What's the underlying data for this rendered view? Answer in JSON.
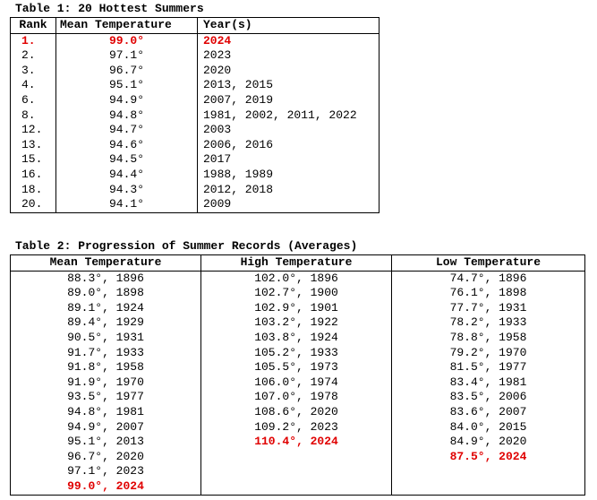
{
  "table1": {
    "caption": "Table 1: 20 Hottest Summers",
    "headers": [
      "Rank",
      "Mean Temperature",
      "Year(s)"
    ],
    "rows": [
      {
        "rank": "1.",
        "temp": "99.0°",
        "years": "2024",
        "highlight": true
      },
      {
        "rank": "2.",
        "temp": "97.1°",
        "years": "2023",
        "highlight": false
      },
      {
        "rank": "3.",
        "temp": "96.7°",
        "years": "2020",
        "highlight": false
      },
      {
        "rank": "4.",
        "temp": "95.1°",
        "years": "2013, 2015",
        "highlight": false
      },
      {
        "rank": "6.",
        "temp": "94.9°",
        "years": "2007, 2019",
        "highlight": false
      },
      {
        "rank": "8.",
        "temp": "94.8°",
        "years": "1981, 2002, 2011, 2022",
        "highlight": false
      },
      {
        "rank": "12.",
        "temp": "94.7°",
        "years": "2003",
        "highlight": false
      },
      {
        "rank": "13.",
        "temp": "94.6°",
        "years": "2006, 2016",
        "highlight": false
      },
      {
        "rank": "15.",
        "temp": "94.5°",
        "years": "2017",
        "highlight": false
      },
      {
        "rank": "16.",
        "temp": "94.4°",
        "years": "1988, 1989",
        "highlight": false
      },
      {
        "rank": "18.",
        "temp": "94.3°",
        "years": "2012, 2018",
        "highlight": false
      },
      {
        "rank": "20.",
        "temp": "94.1°",
        "years": "2009",
        "highlight": false
      }
    ]
  },
  "table2": {
    "caption": "Table 2: Progression of Summer Records (Averages)",
    "headers": [
      "Mean Temperature",
      "High Temperature",
      "Low Temperature"
    ],
    "mean": [
      {
        "text": "88.3°, 1896",
        "highlight": false
      },
      {
        "text": "89.0°, 1898",
        "highlight": false
      },
      {
        "text": "89.1°, 1924",
        "highlight": false
      },
      {
        "text": "89.4°, 1929",
        "highlight": false
      },
      {
        "text": "90.5°, 1931",
        "highlight": false
      },
      {
        "text": "91.7°, 1933",
        "highlight": false
      },
      {
        "text": "91.8°, 1958",
        "highlight": false
      },
      {
        "text": "91.9°, 1970",
        "highlight": false
      },
      {
        "text": "93.5°, 1977",
        "highlight": false
      },
      {
        "text": "94.8°, 1981",
        "highlight": false
      },
      {
        "text": "94.9°, 2007",
        "highlight": false
      },
      {
        "text": "95.1°, 2013",
        "highlight": false
      },
      {
        "text": "96.7°, 2020",
        "highlight": false
      },
      {
        "text": "97.1°, 2023",
        "highlight": false
      },
      {
        "text": "99.0°, 2024",
        "highlight": true
      }
    ],
    "high": [
      {
        "text": "102.0°, 1896",
        "highlight": false
      },
      {
        "text": "102.7°, 1900",
        "highlight": false
      },
      {
        "text": "102.9°, 1901",
        "highlight": false
      },
      {
        "text": "103.2°, 1922",
        "highlight": false
      },
      {
        "text": "103.8°, 1924",
        "highlight": false
      },
      {
        "text": "105.2°, 1933",
        "highlight": false
      },
      {
        "text": "105.5°, 1973",
        "highlight": false
      },
      {
        "text": "106.0°, 1974",
        "highlight": false
      },
      {
        "text": "107.0°, 1978",
        "highlight": false
      },
      {
        "text": "108.6°, 2020",
        "highlight": false
      },
      {
        "text": "109.2°, 2023",
        "highlight": false
      },
      {
        "text": "110.4°, 2024",
        "highlight": true
      }
    ],
    "low": [
      {
        "text": "74.7°, 1896",
        "highlight": false
      },
      {
        "text": "76.1°, 1898",
        "highlight": false
      },
      {
        "text": "77.7°, 1931",
        "highlight": false
      },
      {
        "text": "78.2°, 1933",
        "highlight": false
      },
      {
        "text": "78.8°, 1958",
        "highlight": false
      },
      {
        "text": "79.2°, 1970",
        "highlight": false
      },
      {
        "text": "81.5°, 1977",
        "highlight": false
      },
      {
        "text": "83.4°, 1981",
        "highlight": false
      },
      {
        "text": "83.5°, 2006",
        "highlight": false
      },
      {
        "text": "83.6°, 2007",
        "highlight": false
      },
      {
        "text": "84.0°, 2015",
        "highlight": false
      },
      {
        "text": "84.9°, 2020",
        "highlight": false
      },
      {
        "text": "87.5°, 2024",
        "highlight": true
      }
    ]
  },
  "colors": {
    "highlight": "#e00000",
    "text": "#000000",
    "border": "#000000"
  }
}
